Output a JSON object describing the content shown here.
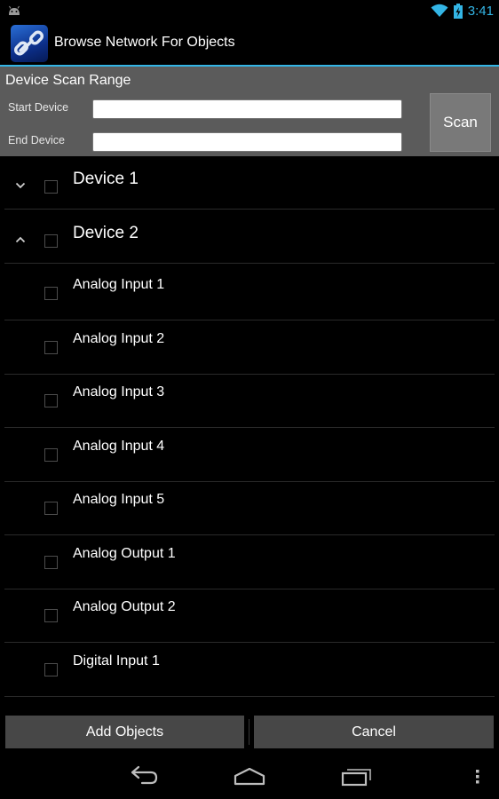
{
  "status_bar": {
    "time": "3:41",
    "icons": [
      "android-icon",
      "wifi-icon",
      "battery-charging-icon"
    ],
    "accent_color": "#33b5e5"
  },
  "action_bar": {
    "title": "Browse Network For Objects",
    "icon": "app-chain-link-icon"
  },
  "scan_range": {
    "heading": "Device Scan Range",
    "start_label": "Start Device",
    "start_value": "",
    "end_label": "End Device",
    "end_value": "",
    "scan_button": "Scan"
  },
  "list": {
    "groups": [
      {
        "label": "Device 1",
        "expanded": false,
        "checked": false
      },
      {
        "label": "Device 2",
        "expanded": true,
        "checked": false
      }
    ],
    "children": [
      {
        "label": "Analog Input 1",
        "checked": false
      },
      {
        "label": "Analog Input 2",
        "checked": false
      },
      {
        "label": "Analog Input 3",
        "checked": false
      },
      {
        "label": "Analog Input 4",
        "checked": false
      },
      {
        "label": "Analog Input 5",
        "checked": false
      },
      {
        "label": "Analog Output 1",
        "checked": false
      },
      {
        "label": "Analog Output 2",
        "checked": false
      },
      {
        "label": "Digital Input 1",
        "checked": false
      }
    ]
  },
  "buttons": {
    "add_objects": "Add Objects",
    "cancel": "Cancel"
  },
  "nav_bar": {
    "icons": [
      "back-icon",
      "home-icon",
      "recent-apps-icon",
      "menu-overflow-icon"
    ]
  }
}
